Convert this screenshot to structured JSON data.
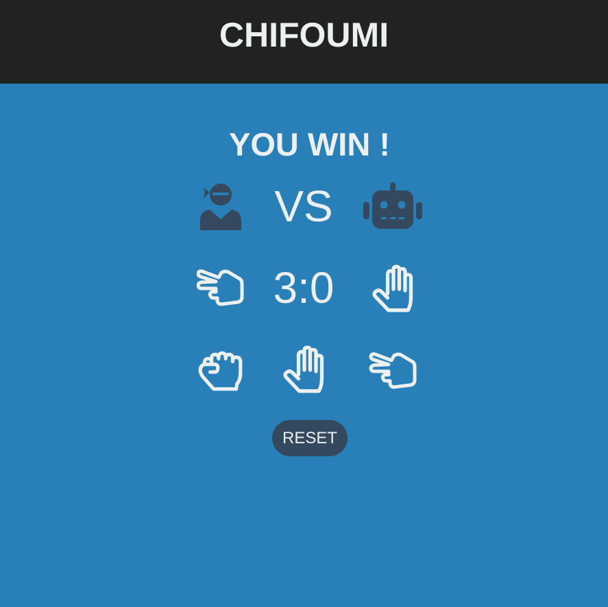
{
  "app": {
    "title": "CHIFOUMI"
  },
  "result": {
    "text": "YOU WIN !"
  },
  "versus": {
    "text": "VS",
    "player_icon": "ninja-icon",
    "cpu_icon": "robot-icon"
  },
  "score": {
    "text": "3:0",
    "player": 3,
    "cpu": 0,
    "player_choice_icon": "hand-scissors-icon",
    "cpu_choice_icon": "hand-paper-icon"
  },
  "choices": [
    {
      "name": "rock",
      "icon": "hand-rock-icon"
    },
    {
      "name": "paper",
      "icon": "hand-paper-icon"
    },
    {
      "name": "scissors",
      "icon": "hand-scissors-icon"
    }
  ],
  "controls": {
    "reset_label": "RESET"
  },
  "colors": {
    "background": "#2980b9",
    "header": "#222222",
    "text": "#ecf0f1",
    "dark": "#34495e"
  }
}
